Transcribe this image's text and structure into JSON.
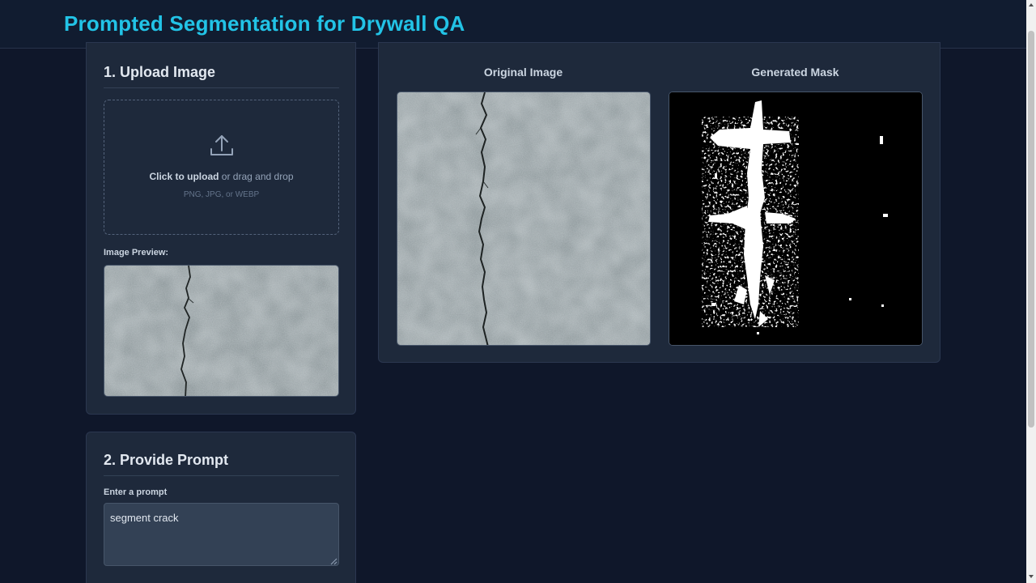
{
  "app": {
    "title": "Prompted Segmentation for Drywall QA"
  },
  "upload": {
    "heading": "1. Upload Image",
    "dropzone_strong": "Click to upload",
    "dropzone_rest": " or drag and drop",
    "dropzone_formats": "PNG, JPG, or WEBP",
    "preview_label": "Image Preview:",
    "icon": "upload-icon"
  },
  "prompt": {
    "heading": "2. Provide Prompt",
    "label": "Enter a prompt",
    "value": "segment crack"
  },
  "results": {
    "original_title": "Original Image",
    "mask_title": "Generated Mask"
  },
  "colors": {
    "accent": "#22c3e6",
    "background": "#0f172a",
    "card": "#1e293b",
    "border": "#2b3750"
  }
}
